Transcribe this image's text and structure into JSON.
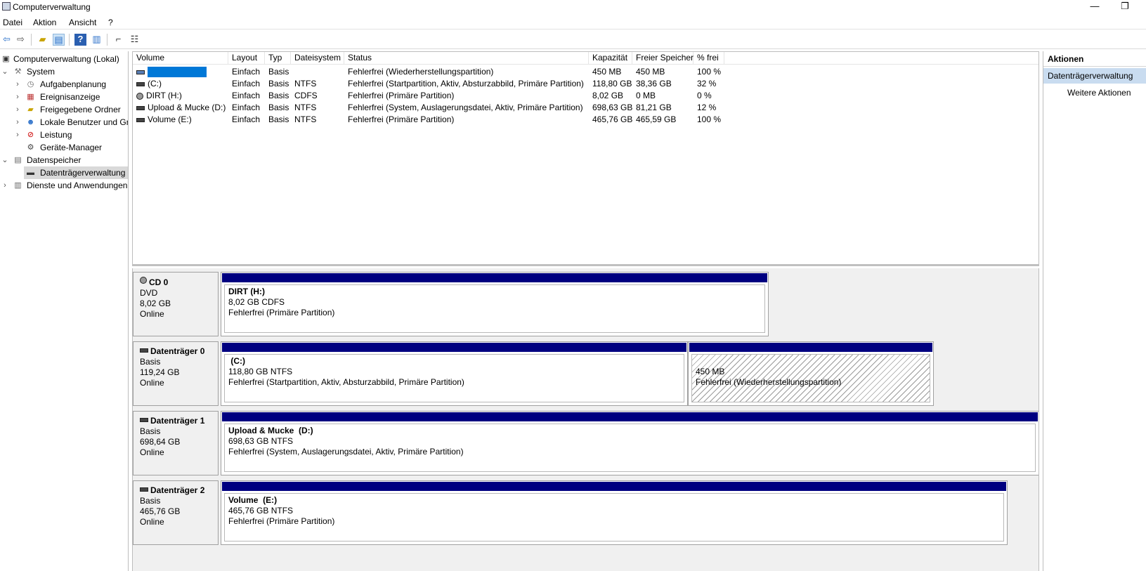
{
  "window": {
    "title": "Computerverwaltung",
    "minimize": "—",
    "restore": "❐"
  },
  "menu": [
    "Datei",
    "Aktion",
    "Ansicht",
    "?"
  ],
  "toolbar_icons": [
    "back-arrow-icon",
    "forward-arrow-icon",
    "up-folder-icon",
    "show-hide-tree-icon",
    "help-icon",
    "show-hide-action-icon",
    "disk-icon",
    "properties-icon"
  ],
  "tree": {
    "root": "Computerverwaltung (Lokal)",
    "system": "System",
    "aufgaben": "Aufgabenplanung",
    "ereignis": "Ereignisanzeige",
    "freigabe": "Freigegebene Ordner",
    "benutzer": "Lokale Benutzer und Gruppen",
    "leistung": "Leistung",
    "geraete": "Geräte-Manager",
    "datenspeicher": "Datenspeicher",
    "datentraeger": "Datenträgerverwaltung",
    "dienste": "Dienste und Anwendungen"
  },
  "list": {
    "headers": [
      "Volume",
      "Layout",
      "Typ",
      "Dateisystem",
      "Status",
      "Kapazität",
      "Freier Speicher",
      "% frei"
    ],
    "rows": [
      {
        "volume": "",
        "layout": "Einfach",
        "typ": "Basis",
        "fs": "",
        "status": "Fehlerfrei (Wiederherstellungspartition)",
        "kap": "450 MB",
        "frei": "450 MB",
        "pct": "100 %"
      },
      {
        "volume": "(C:)",
        "layout": "Einfach",
        "typ": "Basis",
        "fs": "NTFS",
        "status": "Fehlerfrei (Startpartition, Aktiv, Absturzabbild, Primäre Partition)",
        "kap": "118,80 GB",
        "frei": "38,36 GB",
        "pct": "32 %"
      },
      {
        "volume": "DIRT (H:)",
        "layout": "Einfach",
        "typ": "Basis",
        "fs": "CDFS",
        "status": "Fehlerfrei (Primäre Partition)",
        "kap": "8,02 GB",
        "frei": "0 MB",
        "pct": "0 %"
      },
      {
        "volume": "Upload & Mucke (D:)",
        "layout": "Einfach",
        "typ": "Basis",
        "fs": "NTFS",
        "status": "Fehlerfrei (System, Auslagerungsdatei, Aktiv, Primäre Partition)",
        "kap": "698,63 GB",
        "frei": "81,21 GB",
        "pct": "12 %"
      },
      {
        "volume": "Volume (E:)",
        "layout": "Einfach",
        "typ": "Basis",
        "fs": "NTFS",
        "status": "Fehlerfrei (Primäre Partition)",
        "kap": "465,76 GB",
        "frei": "465,59 GB",
        "pct": "100 %"
      }
    ]
  },
  "disks": [
    {
      "name": "CD 0",
      "type": "DVD",
      "size": "8,02 GB",
      "state": "Online",
      "parts": [
        {
          "name": "DIRT  (H:)",
          "size": "8,02 GB CDFS",
          "status": "Fehlerfrei (Primäre Partition)"
        }
      ]
    },
    {
      "name": "Datenträger 0",
      "type": "Basis",
      "size": "119,24 GB",
      "state": "Online",
      "parts": [
        {
          "name": " (C:)",
          "size": "118,80 GB NTFS",
          "status": "Fehlerfrei (Startpartition, Aktiv, Absturzabbild, Primäre Partition)"
        },
        {
          "name": "",
          "size": "450 MB",
          "status": "Fehlerfrei (Wiederherstellungspartition)"
        }
      ]
    },
    {
      "name": "Datenträger 1",
      "type": "Basis",
      "size": "698,64 GB",
      "state": "Online",
      "parts": [
        {
          "name": "Upload & Mucke  (D:)",
          "size": "698,63 GB NTFS",
          "status": "Fehlerfrei (System, Auslagerungsdatei, Aktiv, Primäre Partition)"
        }
      ]
    },
    {
      "name": "Datenträger 2",
      "type": "Basis",
      "size": "465,76 GB",
      "state": "Online",
      "parts": [
        {
          "name": "Volume  (E:)",
          "size": "465,76 GB NTFS",
          "status": "Fehlerfrei (Primäre Partition)"
        }
      ]
    }
  ],
  "actions": {
    "title": "Aktionen",
    "section": "Datenträgerverwaltung",
    "more": "Weitere Aktionen"
  },
  "colors": {
    "partition_bar": "#000080",
    "selection": "#0078d7",
    "action_selected": "#c9dcf0"
  }
}
